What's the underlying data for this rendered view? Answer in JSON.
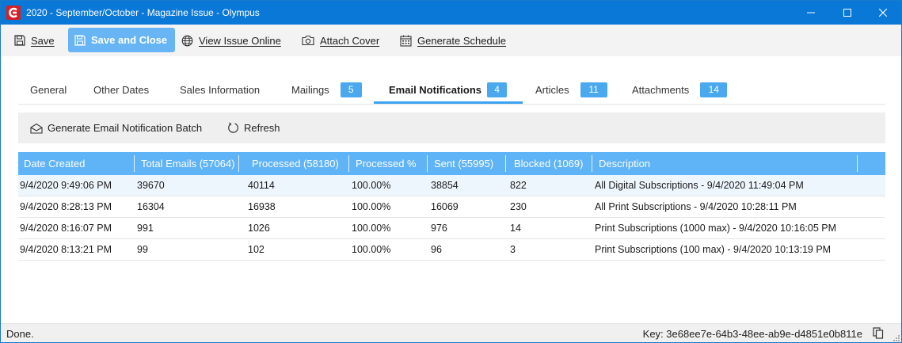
{
  "window": {
    "title": "2020 - September/October - Magazine Issue - Olympus",
    "icon": "olympus-logo",
    "accent_color": "#0a78d7"
  },
  "toolbar": {
    "save_label": "Save",
    "save_close_label": "Save and Close",
    "view_online_label": "View Issue Online",
    "attach_cover_label": "Attach Cover",
    "generate_schedule_label": "Generate Schedule"
  },
  "tabs": [
    {
      "label": "General"
    },
    {
      "label": "Other Dates"
    },
    {
      "label": "Sales Information"
    },
    {
      "label": "Mailings",
      "badge": "5"
    },
    {
      "label": "Email Notifications",
      "badge": "4",
      "active": true
    },
    {
      "label": "Articles",
      "badge": "11"
    },
    {
      "label": "Attachments",
      "badge": "14"
    }
  ],
  "actions": {
    "generate_batch_label": "Generate Email Notification Batch",
    "refresh_label": "Refresh"
  },
  "grid": {
    "header_color": "#5fb3f7",
    "columns": [
      "Date Created",
      "Total Emails (57064)",
      "Processed (58180)",
      "Processed %",
      "Sent (55995)",
      "Blocked (1069)",
      "Description"
    ],
    "rows": [
      [
        "9/4/2020 9:49:06 PM",
        "39670",
        "40114",
        "100.00%",
        "38854",
        "822",
        "All Digital Subscriptions - 9/4/2020 11:49:04 PM"
      ],
      [
        "9/4/2020 8:28:13 PM",
        "16304",
        "16938",
        "100.00%",
        "16069",
        "230",
        "All Print Subscriptions - 9/4/2020 10:28:11 PM"
      ],
      [
        "9/4/2020 8:16:07 PM",
        "991",
        "1026",
        "100.00%",
        "976",
        "14",
        "Print Subscriptions (1000 max) - 9/4/2020 10:16:05 PM"
      ],
      [
        "9/4/2020 8:13:21 PM",
        "99",
        "102",
        "100.00%",
        "96",
        "3",
        "Print Subscriptions (100 max) - 9/4/2020 10:13:19 PM"
      ]
    ]
  },
  "status": {
    "text": "Done.",
    "key": "Key: 3e68ee7e-64b3-48ee-ab9e-d4851e0b811e"
  }
}
